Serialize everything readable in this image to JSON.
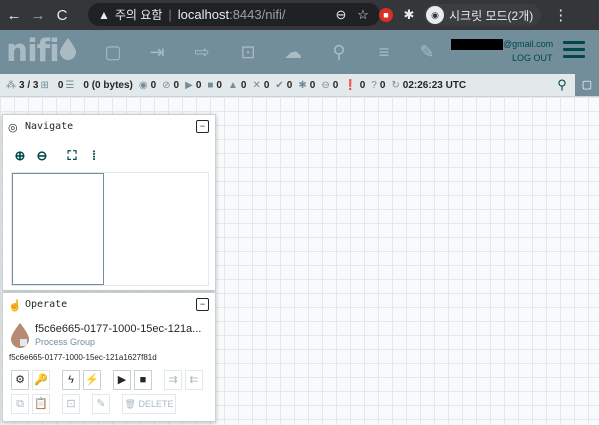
{
  "browser": {
    "insecure_label": "주의 요함",
    "url_host": "localhost",
    "url_rest": ":8443/nifi/",
    "incognito_label": "시크릿 모드(2개)"
  },
  "header": {
    "logo": "nifi",
    "user_email_suffix": "@gmail.com",
    "logout": "LOG OUT"
  },
  "status": {
    "cluster": "3 / 3",
    "queued_count": "0",
    "queued_size": "0 (0 bytes)",
    "transmitting": "0",
    "not_transmitting": "0",
    "running": "0",
    "stopped": "0",
    "invalid": "0",
    "disabled": "0",
    "up_to_date": "0",
    "locally_modified": "0",
    "stale": "0",
    "locally_modified_stale": "0",
    "sync_failure": "0",
    "refresh_time": "02:26:23 UTC"
  },
  "navigate": {
    "title": "Navigate"
  },
  "operate": {
    "title": "Operate",
    "group_name": "f5c6e665-0177-1000-15ec-121a...",
    "group_type": "Process Group",
    "group_id": "f5c6e665-0177-1000-15ec-121a1627f81d",
    "delete_label": "DELETE"
  }
}
